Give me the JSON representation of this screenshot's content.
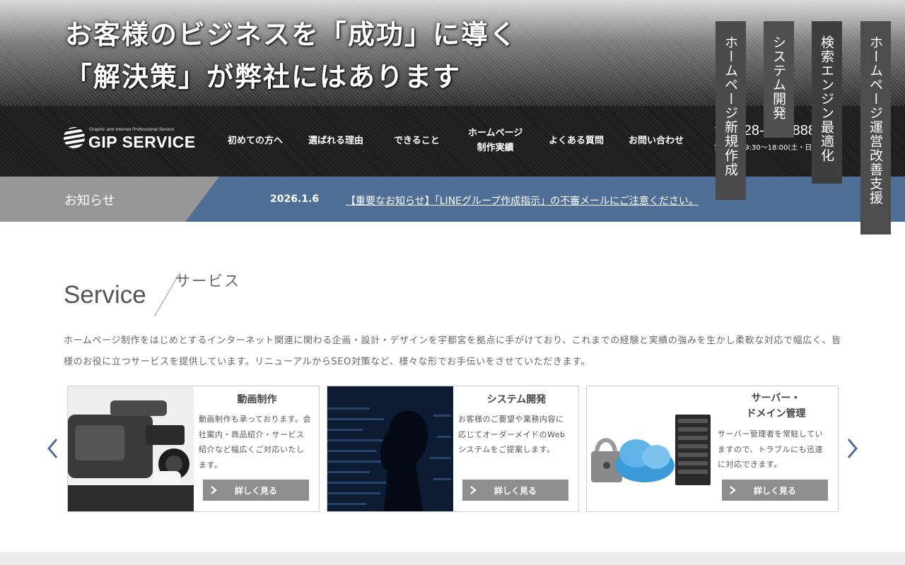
{
  "hero": {
    "line1": "お客様のビジネスを「成功」に導く",
    "line2": "「解決策」が弊社にはあります"
  },
  "logo": {
    "tagline": "Graphic and Internet Professional Service",
    "text": "GIP SERVICE"
  },
  "nav": {
    "items": [
      {
        "label": "初めての方へ"
      },
      {
        "label": "選ばれる理由"
      },
      {
        "label": "できること"
      },
      {
        "label_line1": "ホームページ",
        "label_line2": "制作実績"
      },
      {
        "label": "よくある質問"
      },
      {
        "label": "お問い合わせ"
      }
    ]
  },
  "contact": {
    "phone": "028-678-8888",
    "hours": "営業時間 9:30〜18:00(土・日・祝休)"
  },
  "news": {
    "label": "お知らせ",
    "date": "2026.1.6",
    "link": "【重要なお知らせ】「LINEグループ作成指示」の不審メールにご注意ください。"
  },
  "side_tabs": [
    "ホームページ新規作成",
    "システム開発",
    "検索エンジン最適化",
    "ホームページ運営改善支援"
  ],
  "service": {
    "title": "Service",
    "subtitle": "サービス",
    "description": "ホームページ制作をはじめとするインターネット関連に関わる企画・設計・デザインを宇都宮を拠点に手がけており、これまでの経験と実績の強みを生かし柔軟な対応で幅広く、皆様のお役に立つサービスを提供しています。リニューアルからSEO対策など、様々な形でお手伝いをさせていただきます。",
    "cards": [
      {
        "title": "動画制作",
        "text": "動画制作も承っております。会社案内・商品紹介・サービス紹介など幅広くご対応いたします。",
        "button": "詳しく見る"
      },
      {
        "title": "システム開発",
        "text": "お客様のご要望や業務内容に応じてオーダーメイドのWebシステムをご提案します。",
        "button": "詳しく見る"
      },
      {
        "title_line1": "サーバー・",
        "title_line2": "ドメイン管理",
        "text": "サーバー管理者を常駐していますので、トラブルにも迅速に対応できます。",
        "button": "詳しく見る"
      }
    ]
  },
  "colors": {
    "news_bar": "#4f6f96",
    "news_label": "#979797",
    "button": "#8e8e8e",
    "arrow": "#4f6f96"
  }
}
